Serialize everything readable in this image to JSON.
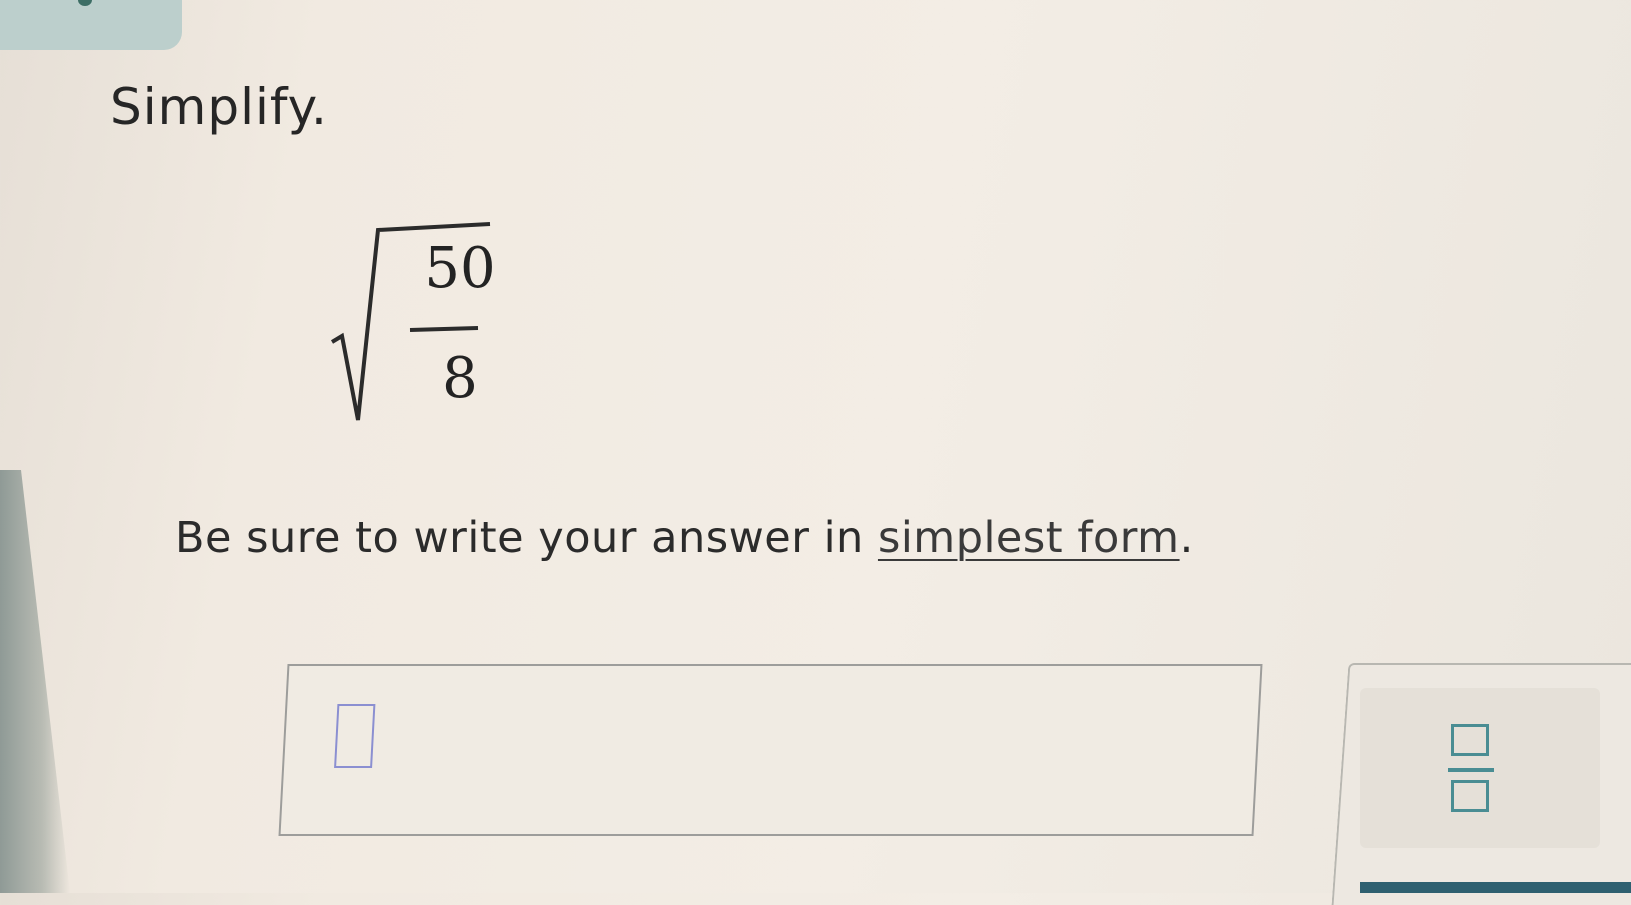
{
  "problem": {
    "instruction": "Simplify.",
    "expression": {
      "type": "square-root-of-fraction",
      "numerator": "50",
      "denominator": "8"
    },
    "note_prefix": "Be sure to write your answer in ",
    "note_link": "simplest form",
    "note_suffix": "."
  },
  "answer": {
    "value": ""
  },
  "keypad": {
    "buttons": [
      {
        "icon": "fraction-icon"
      }
    ]
  },
  "colors": {
    "accent": "#4a8d93",
    "cursor": "#8b8fd1",
    "tab": "#bccfcc"
  }
}
